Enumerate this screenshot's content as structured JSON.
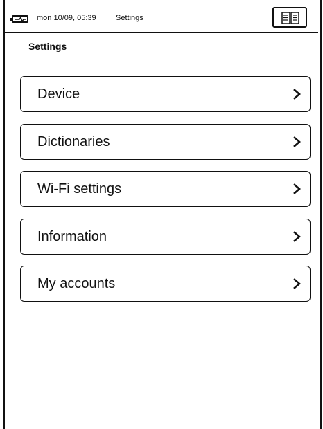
{
  "statusbar": {
    "datetime": "mon 10/09, 05:39",
    "app": "Settings",
    "battery_icon": "battery-charging-icon",
    "view_icon": "two-page-view-icon"
  },
  "header": {
    "title": "Settings"
  },
  "menu": {
    "items": [
      {
        "label": "Device",
        "icon": "chevron-right-icon"
      },
      {
        "label": "Dictionaries",
        "icon": "chevron-right-icon"
      },
      {
        "label": "Wi-Fi settings",
        "icon": "chevron-right-icon"
      },
      {
        "label": "Information",
        "icon": "chevron-right-icon"
      },
      {
        "label": "My accounts",
        "icon": "chevron-right-icon"
      }
    ]
  },
  "colors": {
    "foreground": "#111111",
    "background": "#ffffff"
  }
}
